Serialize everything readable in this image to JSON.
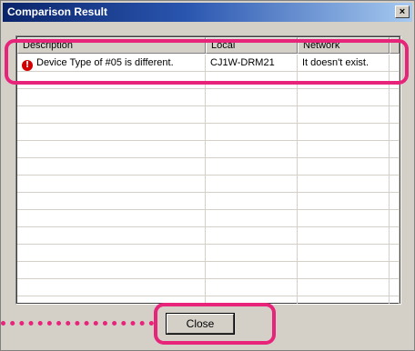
{
  "window": {
    "title": "Comparison Result",
    "close_glyph": "×"
  },
  "table": {
    "columns": [
      "Description",
      "Local",
      "Network",
      ""
    ],
    "rows": [
      {
        "icon": "error-icon",
        "description": "Device Type of #05 is different.",
        "local": "CJ1W-DRM21",
        "network": "It doesn't exist."
      }
    ],
    "empty_row_count": 14
  },
  "footer": {
    "close_label": "Close"
  },
  "colors": {
    "highlight": "#e8237a",
    "error": "#d40000",
    "title_bar": "#0a246a"
  }
}
